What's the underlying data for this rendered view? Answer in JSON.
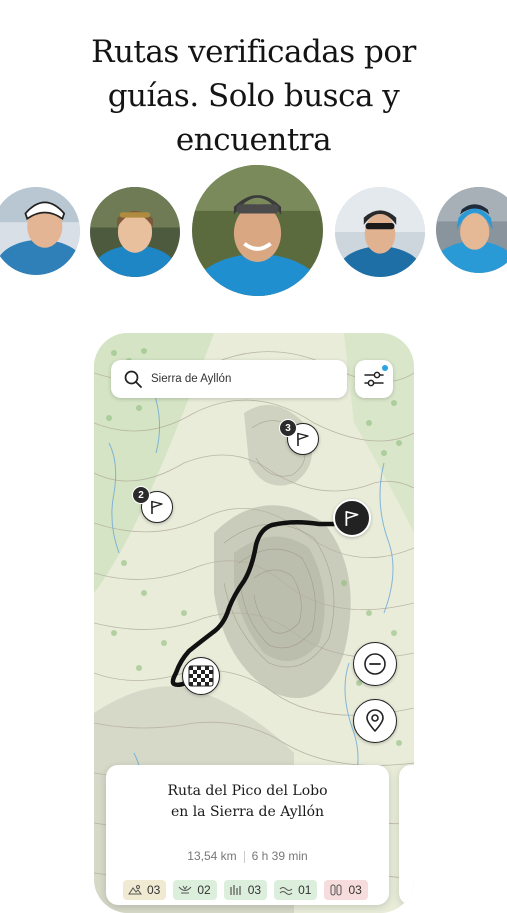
{
  "headline": {
    "line1": "Rutas verificadas por",
    "line2": "guías. Solo busca y",
    "line3": "encuentra"
  },
  "guides": [
    {
      "name": "guide-1",
      "jacket": "#2f7fb8",
      "hair": "#3a2a1e",
      "skin": "#e3b594"
    },
    {
      "name": "guide-2",
      "jacket": "#1f86c6",
      "hair": "#7a5a3a",
      "skin": "#e8c09e"
    },
    {
      "name": "guide-3",
      "jacket": "#1f8fd0",
      "hair": "#3b3b3b",
      "skin": "#d9a883"
    },
    {
      "name": "guide-4",
      "jacket": "#1e6fa6",
      "hair": "#2a2a2a",
      "skin": "#e0b290"
    },
    {
      "name": "guide-5",
      "jacket": "#2a9ad6",
      "hair": "#1d2b3a",
      "skin": "#e5b896"
    }
  ],
  "search": {
    "icon": "search-icon",
    "value": "Sierra de Ayllón"
  },
  "filter": {
    "icon": "sliders-icon",
    "indicator_color": "#2aa4e0"
  },
  "map": {
    "clusters": [
      {
        "count": "3"
      },
      {
        "count": "2"
      }
    ],
    "route_color": "#111111",
    "end_marker_icon": "flag-icon",
    "start_marker_icon": "checkered-flag-icon"
  },
  "controls": {
    "zoom_out_icon": "minus-circle-icon",
    "location_icon": "location-pin-icon"
  },
  "route_card": {
    "title_line1": "Ruta del Pico del Lobo",
    "title_line2": "en la Sierra de Ayllón",
    "distance": "13,54 km",
    "duration": "6 h 39 min",
    "chips": [
      {
        "icon": "landscape-icon",
        "value": "03",
        "color": "#f1ead2"
      },
      {
        "icon": "difficulty-icon",
        "value": "02",
        "color": "#dcefdc"
      },
      {
        "icon": "terrain-icon",
        "value": "03",
        "color": "#dcefdc"
      },
      {
        "icon": "hazard-icon",
        "value": "01",
        "color": "#dcefdc"
      },
      {
        "icon": "footprints-icon",
        "value": "03",
        "color": "#f6dcdc"
      }
    ]
  }
}
